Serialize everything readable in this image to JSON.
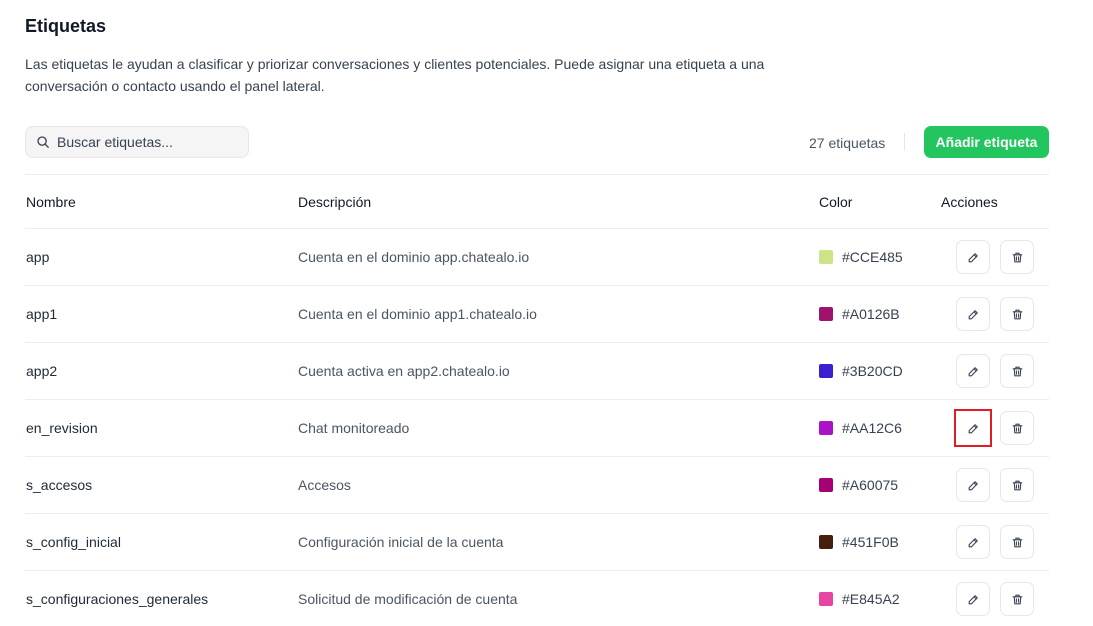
{
  "header": {
    "title": "Etiquetas",
    "description": "Las etiquetas le ayudan a clasificar y priorizar conversaciones y clientes potenciales. Puede asignar una etiqueta a una conversación o contacto usando el panel lateral."
  },
  "toolbar": {
    "search_placeholder": "Buscar etiquetas...",
    "count_label": "27 etiquetas",
    "add_label": "Añadir etiqueta"
  },
  "table": {
    "headers": {
      "name": "Nombre",
      "description": "Descripción",
      "color": "Color",
      "actions": "Acciones"
    },
    "rows": [
      {
        "name": "app",
        "description": "Cuenta en el dominio app.chatealo.io",
        "color": "#CCE485"
      },
      {
        "name": "app1",
        "description": "Cuenta en el dominio app1.chatealo.io",
        "color": "#A0126B"
      },
      {
        "name": "app2",
        "description": "Cuenta activa en app2.chatealo.io",
        "color": "#3B20CD"
      },
      {
        "name": "en_revision",
        "description": "Chat monitoreado",
        "color": "#AA12C6"
      },
      {
        "name": "s_accesos",
        "description": "Accesos",
        "color": "#A60075"
      },
      {
        "name": "s_config_inicial",
        "description": "Configuración inicial de la cuenta",
        "color": "#451F0B"
      },
      {
        "name": "s_configuraciones_generales",
        "description": "Solicitud de modificación de cuenta",
        "color": "#E845A2"
      }
    ]
  },
  "icons": {
    "search": "search-icon",
    "edit": "pencil-icon",
    "delete": "trash-icon"
  },
  "colors": {
    "accent": "#22C55E",
    "highlight": "#E11D24"
  }
}
